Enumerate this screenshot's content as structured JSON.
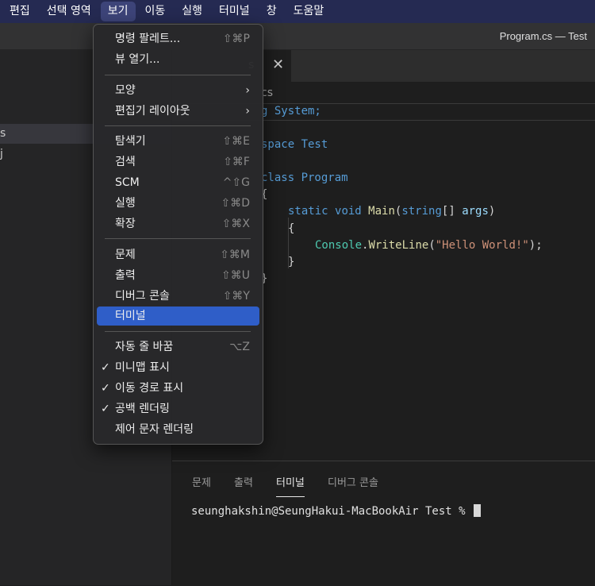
{
  "menubar": {
    "items": [
      "편집",
      "선택 영역",
      "보기",
      "이동",
      "실행",
      "터미널",
      "창",
      "도움말"
    ],
    "active_index": 2
  },
  "window": {
    "title": "Program.cs — Test"
  },
  "sidebar": {
    "rows": [
      "s",
      "j"
    ],
    "selected_index": 0
  },
  "editor": {
    "tab": {
      "label": "s",
      "close": "✕"
    },
    "breadcrumb": "cs"
  },
  "menu": {
    "items": [
      {
        "label": "명령 팔레트...",
        "shortcut": "⇧⌘P"
      },
      {
        "label": "뷰 열기...",
        "shortcut": ""
      },
      {
        "label": "모양",
        "shortcut": "",
        "submenu": true
      },
      {
        "label": "편집기 레이아웃",
        "shortcut": "",
        "submenu": true
      },
      {
        "label": "탐색기",
        "shortcut": "⇧⌘E"
      },
      {
        "label": "검색",
        "shortcut": "⇧⌘F"
      },
      {
        "label": "SCM",
        "shortcut": "^⇧G"
      },
      {
        "label": "실행",
        "shortcut": "⇧⌘D"
      },
      {
        "label": "확장",
        "shortcut": "⇧⌘X"
      },
      {
        "label": "문제",
        "shortcut": "⇧⌘M"
      },
      {
        "label": "출력",
        "shortcut": "⇧⌘U"
      },
      {
        "label": "디버그 콘솔",
        "shortcut": "⇧⌘Y"
      },
      {
        "label": "터미널",
        "shortcut": "",
        "highlighted": true
      },
      {
        "label": "자동 줄 바꿈",
        "shortcut": "⌥Z"
      },
      {
        "label": "미니맵 표시",
        "shortcut": "",
        "checked": true
      },
      {
        "label": "이동 경로 표시",
        "shortcut": "",
        "checked": true
      },
      {
        "label": "공백 렌더링",
        "shortcut": "",
        "checked": true
      },
      {
        "label": "제어 문자 렌더링",
        "shortcut": ""
      }
    ],
    "check_glyph": "✓",
    "submenu_glyph": "›"
  },
  "code": {
    "line1": "g System;",
    "line2": "space Test",
    "line3": "class Program",
    "line4": "{",
    "line5_kw1": "static",
    "line5_kw2": "void",
    "line5_fn": "Main",
    "line5_open": "(",
    "line5_type": "string",
    "line5_rest": "[] ",
    "line5_param": "args",
    "line5_close": ")",
    "line6": "{",
    "line7_obj": "Console",
    "line7_dot": ".",
    "line7_fn": "WriteLine",
    "line7_open": "(",
    "line7_str": "\"Hello World!\"",
    "line7_close": ");",
    "line8": "}",
    "line9": "}"
  },
  "panel": {
    "tabs": [
      "문제",
      "출력",
      "터미널",
      "디버그 콘솔"
    ],
    "active_index": 2,
    "terminal_prompt": "seunghakshin@SeungHakui-MacBookAir Test % "
  },
  "colors": {
    "menubar_bg": "#252a52",
    "highlight": "#2f5ec8",
    "keyword": "#569cd6",
    "type": "#4ec9b0",
    "function": "#dcdcaa",
    "string": "#ce9178"
  }
}
